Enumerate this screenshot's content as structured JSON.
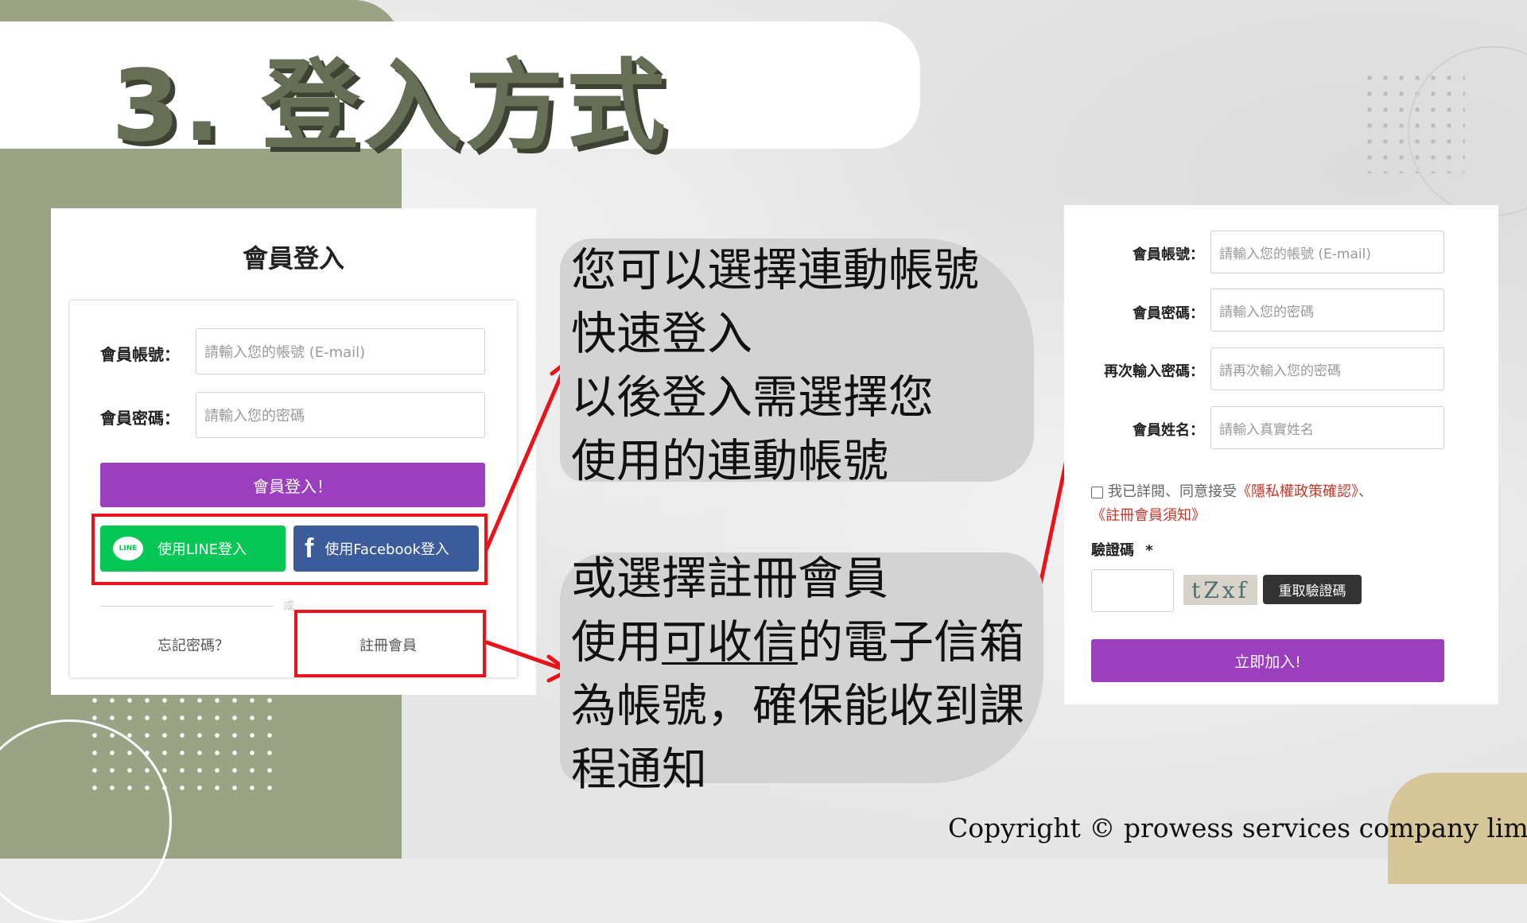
{
  "slide": {
    "title": "3. 登入方式",
    "copyright": "Copyright © prowess services company limited"
  },
  "login_panel": {
    "heading": "會員登入",
    "account_label": "會員帳號：",
    "account_placeholder": "請輸入您的帳號 (E-mail)",
    "password_label": "會員密碼：",
    "password_placeholder": "請輸入您的密碼",
    "login_button": "會員登入！",
    "line_button": "使用LINE登入",
    "line_logo_text": "LINE",
    "facebook_button": "使用Facebook登入",
    "facebook_logo": "f",
    "divider_text": "或",
    "forgot_password": "忘記密碼？",
    "register": "註冊會員"
  },
  "explanation": {
    "linked_lines": [
      "您可以選擇連動帳號",
      "快速登入",
      "以後登入需選擇您",
      "使用的連動帳號"
    ],
    "register_line1": "或選擇註冊會員",
    "register_line2_pre": "使用",
    "register_line2_underlined": "可收信",
    "register_line2_post": "的電子信箱",
    "register_line3": "為帳號，確保能收到課",
    "register_line4": "程通知"
  },
  "register_panel": {
    "account_label": "會員帳號：",
    "account_placeholder": "請輸入您的帳號 (E-mail)",
    "password_label": "會員密碼：",
    "password_placeholder": "請輸入您的密碼",
    "confirm_label": "再次輸入密碼：",
    "confirm_placeholder": "請再次輸入您的密碼",
    "name_label": "會員姓名：",
    "name_placeholder": "請輸入真實姓名",
    "agree_prefix": "我已詳閱、同意接受",
    "privacy_link": "《隱私權政策確認》",
    "agree_sep": "、",
    "terms_link": "《註冊會員須知》",
    "captcha_label": "驗證碼",
    "captcha_required": "*",
    "captcha_text": "tZxf",
    "captcha_refresh": "重取驗證碼",
    "join_button": "立即加入!"
  },
  "colors": {
    "olive": "#9aa383",
    "title_text": "#666e55",
    "purple_button": "#9c3fbf",
    "line_green": "#06c755",
    "facebook_blue": "#3b5b9a",
    "highlight_red": "#e8141a"
  }
}
